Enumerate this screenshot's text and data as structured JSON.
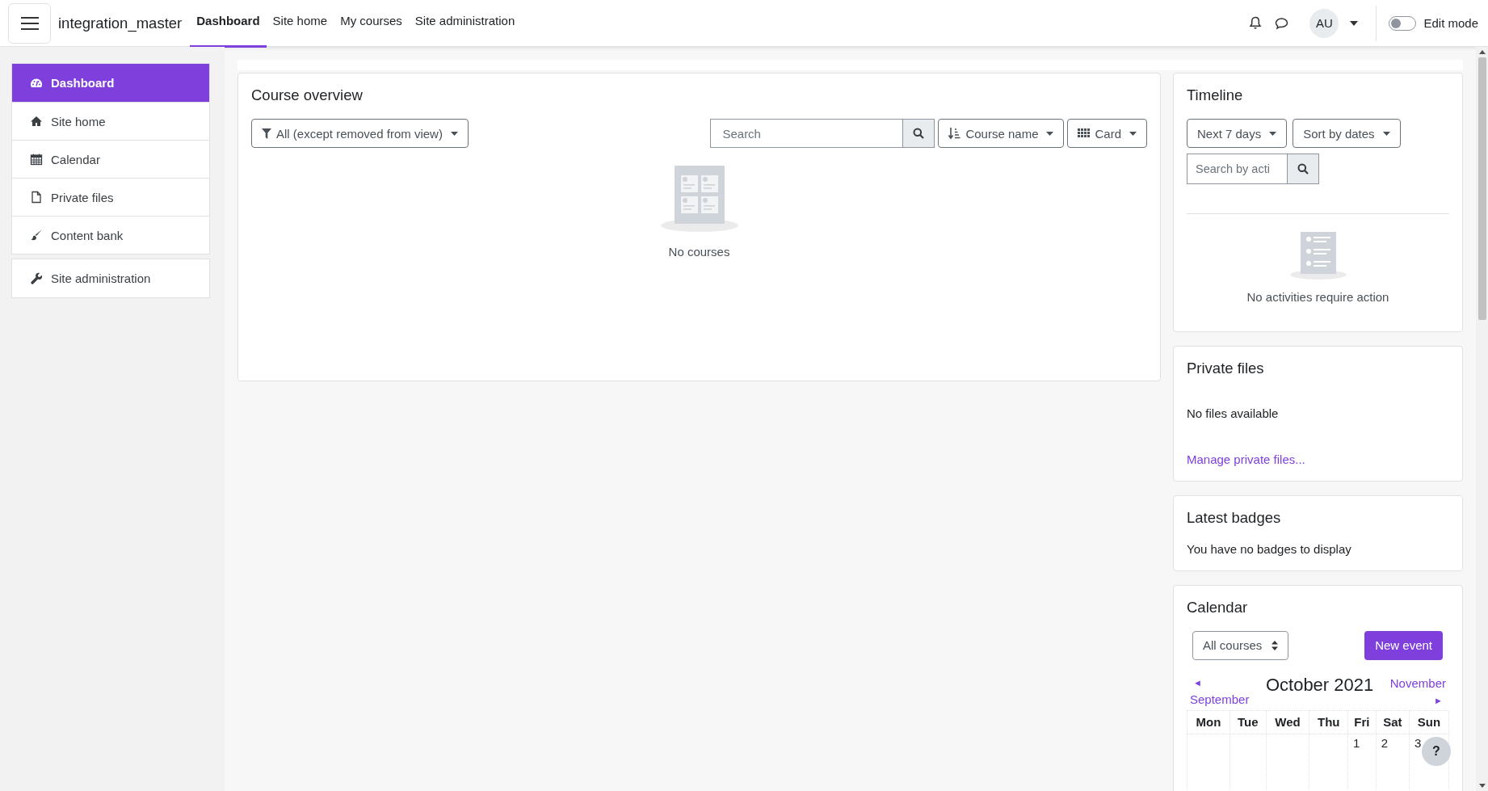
{
  "navbar": {
    "site_name": "integration_master",
    "links": [
      {
        "label": "Dashboard",
        "selected": true
      },
      {
        "label": "Site home",
        "selected": false
      },
      {
        "label": "My courses",
        "selected": false
      },
      {
        "label": "Site administration",
        "selected": false
      }
    ],
    "user_initials": "AU",
    "edit_mode": {
      "label": "Edit mode",
      "on": false
    }
  },
  "sidebar": {
    "items": [
      {
        "label": "Dashboard",
        "selected": true
      },
      {
        "label": "Site home",
        "selected": false
      },
      {
        "label": "Calendar",
        "selected": false
      },
      {
        "label": "Private files",
        "selected": false
      },
      {
        "label": "Content bank",
        "selected": false
      }
    ],
    "admin_item": {
      "label": "Site administration",
      "selected": false
    }
  },
  "course_overview": {
    "title": "Course overview",
    "filter": "All (except removed from view)",
    "search": {
      "placeholder": "Search"
    },
    "sort": "Course name",
    "view": "Card",
    "empty_text": "No courses"
  },
  "timeline": {
    "title": "Timeline",
    "range": "Next 7 days",
    "sort": "Sort by dates",
    "search": {
      "placeholder": "Search by acti"
    },
    "empty_text": "No activities require action"
  },
  "private_files": {
    "title": "Private files",
    "text": "No files available",
    "link": "Manage private files..."
  },
  "latest_badges": {
    "title": "Latest badges",
    "text": "You have no badges to display"
  },
  "calendar": {
    "title": "Calendar",
    "course_select": "All courses",
    "new_event": "New event",
    "prev_arrow": "◄",
    "prev_month": "September",
    "month": "October 2021",
    "next_month": "November",
    "next_arrow": "►",
    "weekdays": [
      "Mon",
      "Tue",
      "Wed",
      "Thu",
      "Fri",
      "Sat",
      "Sun"
    ],
    "first_week_days": [
      "1",
      "2",
      "3"
    ]
  },
  "help_button": "?"
}
